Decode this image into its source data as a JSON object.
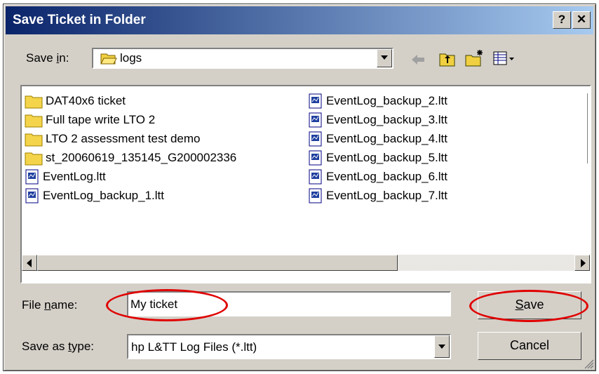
{
  "window": {
    "title": "Save Ticket in Folder",
    "help_label": "?",
    "close_label": "✕"
  },
  "save_in": {
    "label_pre": "Save ",
    "label_key": "i",
    "label_post": "n:",
    "value": "logs"
  },
  "toolbar": {
    "icons": [
      "back-arrow-icon",
      "up-folder-icon",
      "new-folder-icon",
      "view-menu-icon"
    ]
  },
  "files": {
    "column1": [
      {
        "name": "DAT40x6 ticket",
        "type": "folder"
      },
      {
        "name": "Full tape write LTO 2",
        "type": "folder"
      },
      {
        "name": "LTO 2 assessment test demo",
        "type": "folder"
      },
      {
        "name": "st_20060619_135145_G200002336",
        "type": "folder"
      },
      {
        "name": "EventLog.ltt",
        "type": "file"
      },
      {
        "name": "EventLog_backup_1.ltt",
        "type": "file"
      }
    ],
    "column2": [
      {
        "name": "EventLog_backup_2.ltt",
        "type": "file"
      },
      {
        "name": "EventLog_backup_3.ltt",
        "type": "file"
      },
      {
        "name": "EventLog_backup_4.ltt",
        "type": "file"
      },
      {
        "name": "EventLog_backup_5.ltt",
        "type": "file"
      },
      {
        "name": "EventLog_backup_6.ltt",
        "type": "file"
      },
      {
        "name": "EventLog_backup_7.ltt",
        "type": "file"
      }
    ]
  },
  "file_name": {
    "label_pre": "File ",
    "label_key": "n",
    "label_post": "ame:",
    "value": "My ticket"
  },
  "save_as_type": {
    "label_pre": "Save as ",
    "label_key": "t",
    "label_post": "ype:",
    "value": "hp L&TT Log Files (*.ltt)"
  },
  "buttons": {
    "save_key": "S",
    "save_rest": "ave",
    "cancel": "Cancel"
  },
  "colors": {
    "title_start": "#0a246a",
    "title_end": "#a6caf0",
    "highlight": "#e00000",
    "dialog_bg": "#d4d0c8"
  }
}
